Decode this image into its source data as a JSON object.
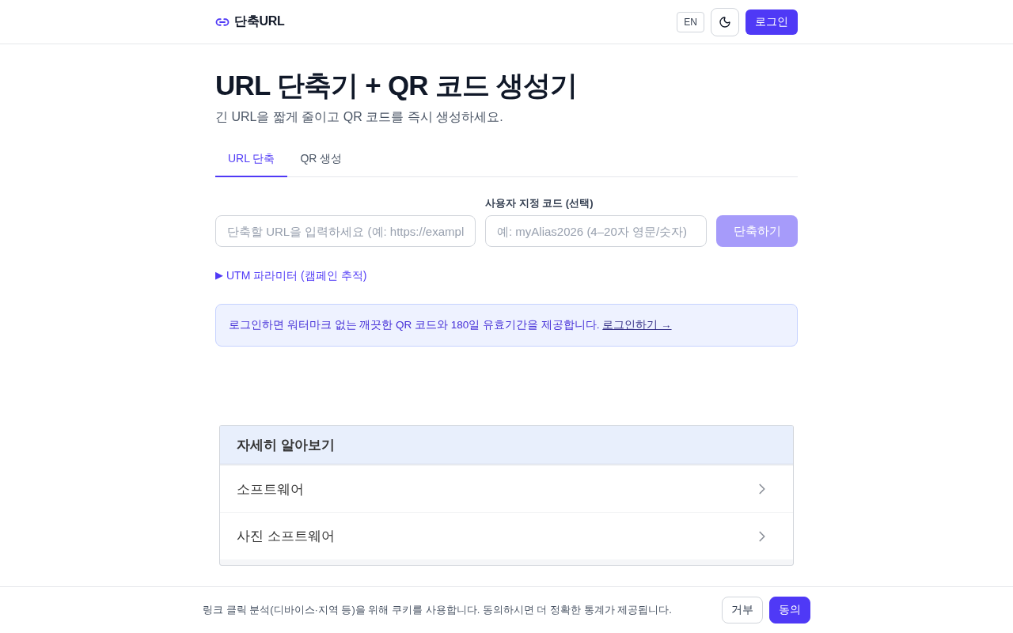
{
  "header": {
    "logo": "단축URL",
    "language_button": "EN",
    "login_button": "로그인"
  },
  "hero": {
    "title": "URL 단축기 + QR 코드 생성기",
    "subtitle": "긴 URL을 짧게 줄이고 QR 코드를 즉시 생성하세요."
  },
  "tabs": [
    {
      "label": "URL 단축",
      "selected": true
    },
    {
      "label": "QR 생성",
      "selected": false
    }
  ],
  "form": {
    "url_field": {
      "placeholder": "단축할 URL을 입력하세요 (예: https://exampl"
    },
    "alias_field": {
      "label": "사용자 지정 코드 (선택)",
      "placeholder": "예: myAlias2026 (4–20자 영문/숫자)"
    },
    "submit_button": {
      "label": "단축하기",
      "disabled": true
    }
  },
  "utm_toggle": {
    "marker": "▶",
    "label": "UTM 파라미터 (캠페인 추적)",
    "expanded": false
  },
  "notice": {
    "text": "로그인하면 워터마크 없는 깨끗한 QR 코드와 180일 유효기간을 제공합니다.",
    "link": "로그인하기 →"
  },
  "learn_more": {
    "title": "자세히 알아보기",
    "items": [
      "소프트웨어",
      "사진 소프트웨어"
    ]
  },
  "cookie_bar": {
    "text": "링크 클릭 분석(디바이스·지역 등)을 위해 쿠키를 사용합니다. 동의하시면 더 정확한 통계가 제공됩니다.",
    "buttons": [
      {
        "label": "거부",
        "kind": "secondary"
      },
      {
        "label": "동의",
        "kind": "primary"
      }
    ]
  }
}
